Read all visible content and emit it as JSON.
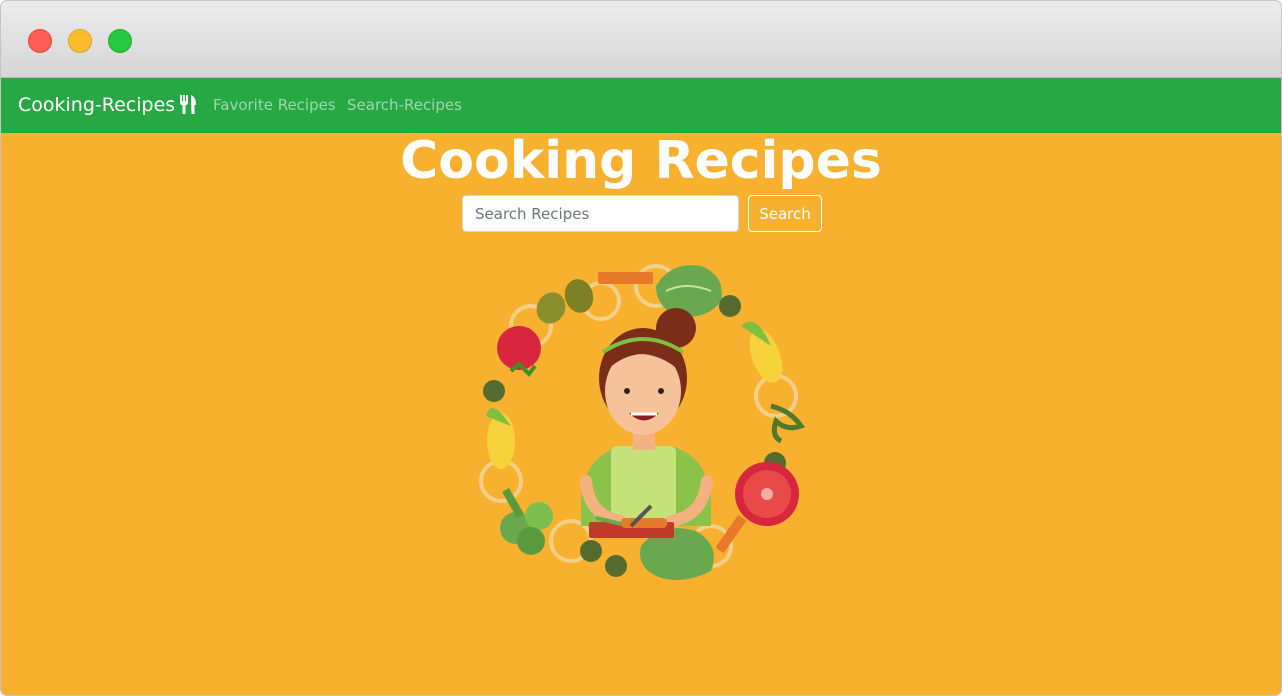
{
  "navbar": {
    "brand": "Cooking-Recipes",
    "brand_icon": "utensils-icon",
    "links": [
      {
        "label": "Favorite Recipes"
      },
      {
        "label": "Search-Recipes"
      }
    ]
  },
  "hero": {
    "title": "Cooking Recipes"
  },
  "search": {
    "placeholder": "Search Recipes",
    "value": "",
    "button_label": "Search"
  },
  "illustration": {
    "subject": "cook-chopping-vegetables-illustration"
  },
  "colors": {
    "page_bg": "#f7b12f",
    "navbar_bg": "#28a745"
  }
}
